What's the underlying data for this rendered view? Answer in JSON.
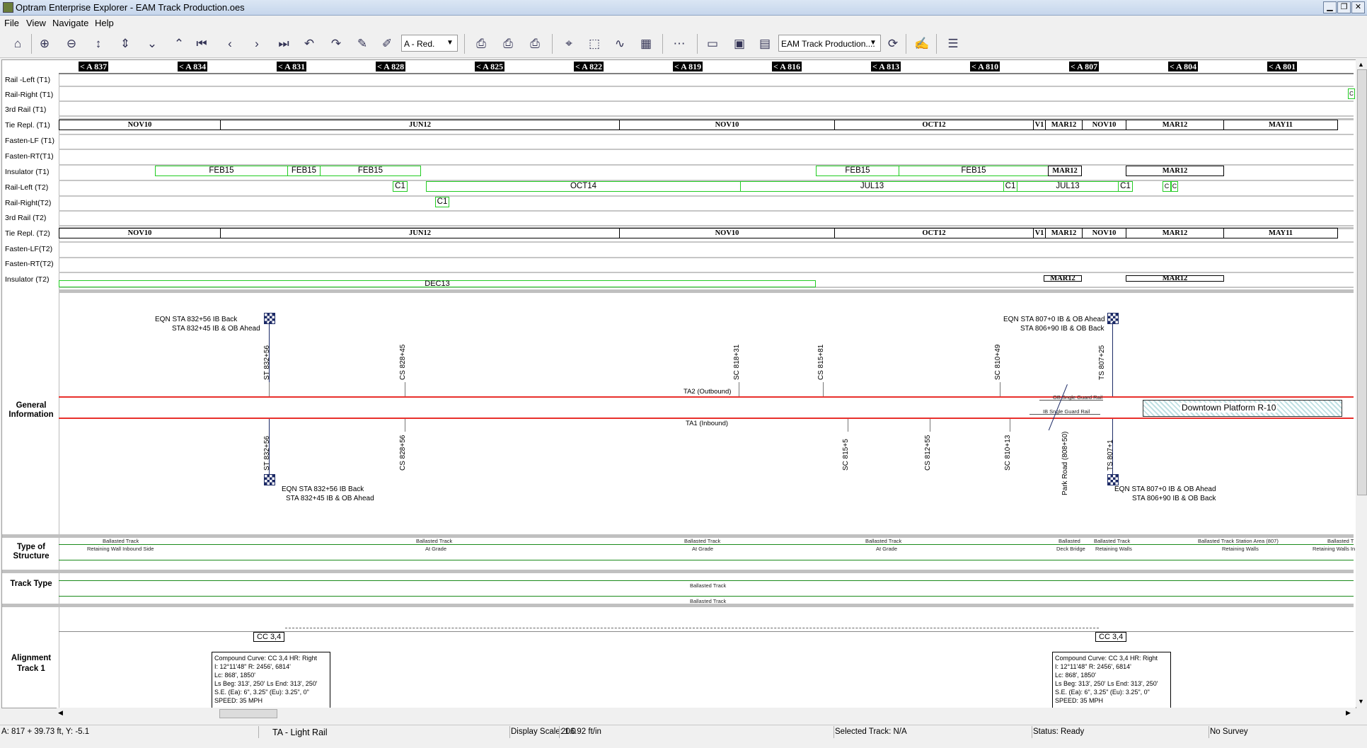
{
  "window": {
    "title": "Optram Enterprise Explorer - EAM Track Production.oes"
  },
  "menu": [
    "File",
    "View",
    "Navigate",
    "Help"
  ],
  "toolbar": {
    "layer_combo": "A - Red.",
    "file_combo": "EAM Track Production...."
  },
  "stations": [
    "< A 837",
    "< A 834",
    "< A 831",
    "< A 828",
    "< A 825",
    "< A 822",
    "< A 819",
    "< A 816",
    "< A 813",
    "< A 810",
    "< A 807",
    "< A 804",
    "< A 801"
  ],
  "rows": {
    "rail_left_t1": "Rail -Left (T1)",
    "rail_right_t1": "Rail-Right (T1)",
    "third_rail_t1": "3rd Rail (T1)",
    "tie_repl_t1": "Tie Repl. (T1)",
    "fasten_lf_t1": "Fasten-LF (T1)",
    "fasten_rt_t1": "Fasten-RT(T1)",
    "insulator_t1": "Insulator (T1)",
    "rail_left_t2": "Rail-Left (T2)",
    "rail_right_t2": "Rail-Right(T2)",
    "third_rail_t2": "3rd Rail (T2)",
    "tie_repl_t2": "Tie Repl. (T2)",
    "fasten_lf_t2": "Fasten-LF(T2)",
    "fasten_rt_t2": "Fasten-RT(T2)",
    "insulator_t2": "Insulator (T2)"
  },
  "tie_segments": [
    "NOV10",
    "JUN12",
    "NOV10",
    "OCT12",
    "V1",
    "MAR12",
    "NOV10",
    "MAR12",
    "MAY11"
  ],
  "insulator_t1_segments": [
    "FEB15",
    "FEB15",
    "FEB15",
    "FEB15",
    "FEB15",
    "MAR12",
    "MAR12"
  ],
  "rail_left_t2_segments": [
    "C1",
    "OCT14",
    "JUL13",
    "C1",
    "JUL13",
    "C1",
    "C",
    "C"
  ],
  "rail_right_t2_segments": [
    "C1"
  ],
  "rail_right_t1_segment": "C",
  "insulator_t2_segments": [
    "DEC13",
    "MAR12",
    "MAR12"
  ],
  "general": {
    "label": "General Information",
    "eqn_tl_1": "EQN STA 832+56 IB Back",
    "eqn_tl_2": "STA 832+45 IB & OB Ahead",
    "eqn_tr_1": "EQN STA 807+0 IB & OB Ahead",
    "eqn_tr_2": "STA 806+90 IB & OB Back",
    "eqn_bl_1": "EQN STA 832+56 IB Back",
    "eqn_bl_2": "STA 832+45 IB & OB Ahead",
    "eqn_br_1": "EQN STA 807+0 IB & OB Ahead",
    "eqn_br_2": "STA 806+90 IB & OB Back",
    "top_markers": [
      "ST 832+56",
      "CS 828+45",
      "SC 818+31",
      "CS 815+81",
      "SC 810+49",
      "TS 807+25"
    ],
    "bottom_markers": [
      "ST 832+56",
      "CS 828+56",
      "SC 815+5",
      "CS 812+55",
      "SC 810+13",
      "TS 807+1"
    ],
    "ta2": "TA2 (Outbound)",
    "ta1": "TA1 (Inbound)",
    "ob_guard": "OB Sngle Guard Rail",
    "ib_guard": "IB Sngle Guard Rail",
    "road": "Park Road (808+50)",
    "platform": "Downtown Platform R-10"
  },
  "structure": {
    "label": "Type of Structure",
    "items": [
      {
        "t": "Ballasted Track",
        "b": "Retaining Wall Inbound Side"
      },
      {
        "t": "Ballasted Track",
        "b": "At Grade"
      },
      {
        "t": "Ballasted Track",
        "b": "At Grade"
      },
      {
        "t": "Ballasted Track",
        "b": "At Grade"
      },
      {
        "t": "Ballasted",
        "b": "Deck Bridge"
      },
      {
        "t": "Ballasted Track",
        "b": "Retaining Walls"
      },
      {
        "t": "Ballasted Track Station Area (807)",
        "b": "Retaining Walls"
      },
      {
        "t": "Ballasted T",
        "b": "Retaining Walls In"
      }
    ]
  },
  "track_type": {
    "label": "Track Type",
    "line1": "Ballasted Track",
    "line2": "Ballasted Track"
  },
  "alignment": {
    "label": "Alignment Track 1",
    "cc_left": "CC 3,4",
    "cc_right": "CC 3,4",
    "curve_lines": [
      "Compound Curve: CC 3,4 HR: Right",
      "I: 12°11'48\"  R: 2456', 6814'",
      "Lc: 868', 1850'",
      "Ls Beg: 313', 250'  Ls End: 313', 250'",
      "S.E. (Ea): 6\", 3.25\"  (Eu): 3.25\", 0\"",
      "SPEED: 35 MPH"
    ]
  },
  "status": {
    "coords": "A: 817 + 39.73 ft, Y: -5.1",
    "track": "TA - Light Rail",
    "display_scale": "Display Scale: 1.0",
    "ft_per_in": "206.92 ft/in",
    "selected_track": "Selected Track: N/A",
    "status": "Status: Ready",
    "survey": "No Survey"
  },
  "colors": {
    "accent_red": "#e8302c",
    "green": "#22cc22",
    "navy": "#1c2a66"
  }
}
